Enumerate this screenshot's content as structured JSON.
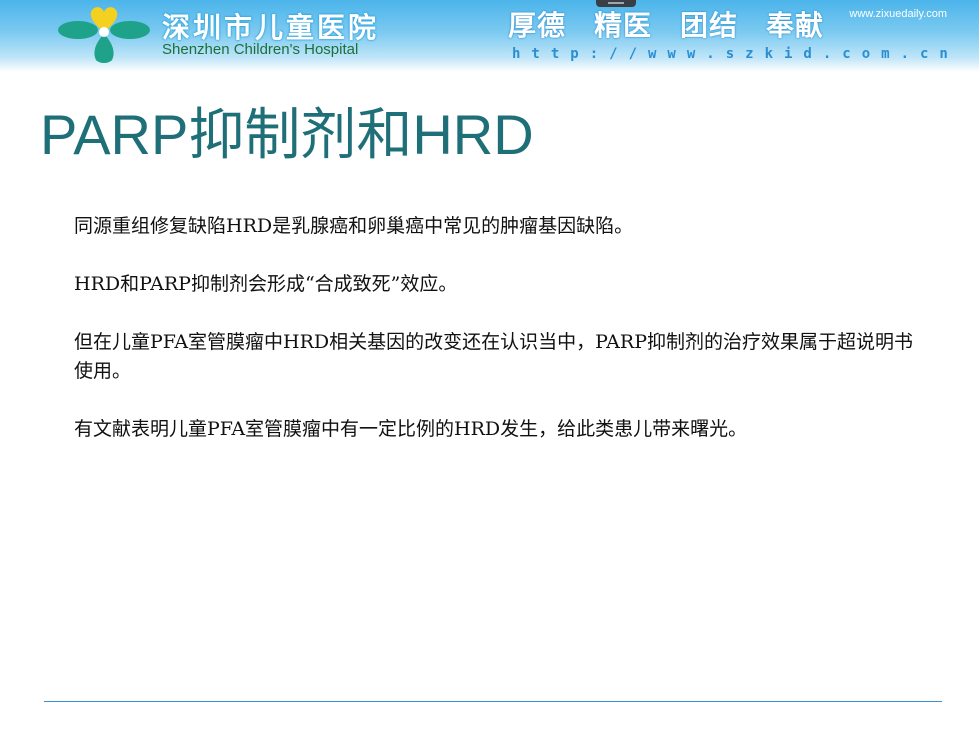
{
  "header": {
    "hospital_name_cn": "深圳市儿童医院",
    "hospital_name_en": "Shenzhen Children's Hospital",
    "motto": [
      "厚德",
      "精医",
      "团结",
      "奉献"
    ],
    "website_top": "www.zixuedaily.com",
    "url": "http://www.szkid.com.cn",
    "logo_icon": "clover-heart-logo-icon"
  },
  "slide": {
    "title": "PARP抑制剂和HRD",
    "paragraphs": [
      "同源重组修复缺陷HRD是乳腺癌和卵巢癌中常见的肿瘤基因缺陷。",
      "HRD和PARP抑制剂会形成“合成致死”效应。",
      "但在儿童PFA室管膜瘤中HRD相关基因的改变还在认识当中，PARP抑制剂的治疗效果属于超说明书使用。",
      "有文献表明儿童PFA室管膜瘤中有一定比例的HRD发生，给此类患儿带来曙光。"
    ]
  },
  "colors": {
    "header_blue": "#4bb4ea",
    "title_teal": "#1e6f78",
    "divider_blue": "#3d8fd0",
    "logo_green": "#1ea38a",
    "logo_yellow": "#f4d020"
  }
}
